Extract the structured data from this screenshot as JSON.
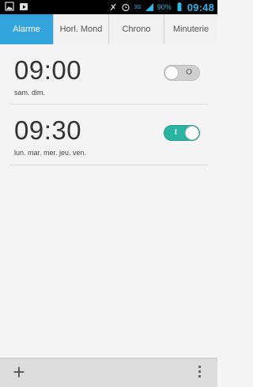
{
  "status_bar": {
    "left_icons": [
      "image-icon",
      "play-store-icon"
    ],
    "right_icons": [
      "muted-icon",
      "alarm-icon",
      "signal-icon"
    ],
    "network": "3G",
    "battery_percent": "90%",
    "time": "09:48",
    "accent": "#33b5e5"
  },
  "tabs": [
    {
      "label": "Alarme",
      "active": true
    },
    {
      "label": "Horl. Mond",
      "active": false
    },
    {
      "label": "Chrono",
      "active": false
    },
    {
      "label": "Minuterie",
      "active": false
    }
  ],
  "alarms": [
    {
      "time": "09:00",
      "days": "sam. dim.",
      "enabled": false,
      "toggle_text": "O"
    },
    {
      "time": "09:30",
      "days": "lun. mar. mer. jeu. ven.",
      "enabled": true,
      "toggle_text": "I"
    }
  ],
  "bottom_bar": {
    "add_symbol": "+",
    "add_icon": "plus-icon",
    "menu_icon": "overflow-menu-icon"
  },
  "colors": {
    "tab_active": "#33a3dc",
    "toggle_on": "#2bb3a3"
  }
}
